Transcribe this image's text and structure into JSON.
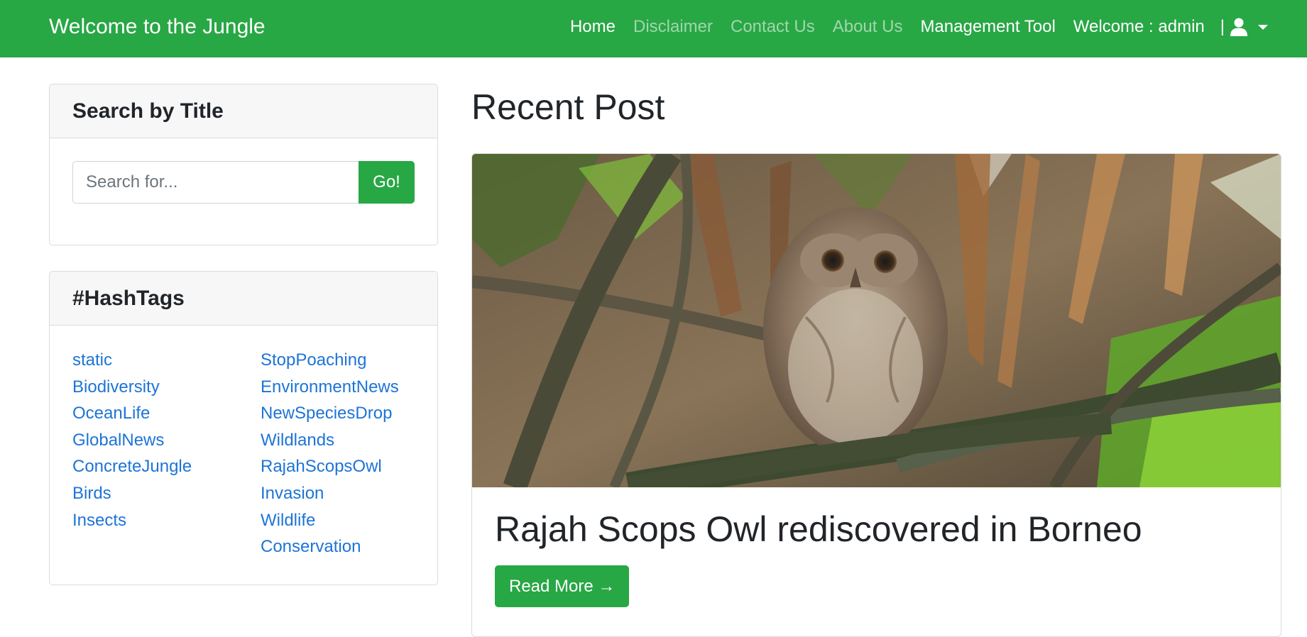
{
  "navbar": {
    "brand": "Welcome to the Jungle",
    "links": [
      "Home",
      "Disclaimer",
      "Contact Us",
      "About Us",
      "Management Tool"
    ],
    "welcome": "Welcome : admin",
    "separator": "|",
    "user_icon": "user-icon",
    "caret_icon": "caret-down-icon"
  },
  "search": {
    "title": "Search by Title",
    "placeholder": "Search for...",
    "value": "",
    "button": "Go!"
  },
  "hashtags": {
    "title": "#HashTags",
    "left": [
      "static",
      "Biodiversity",
      "OceanLife",
      "GlobalNews",
      "ConcreteJungle",
      "Birds",
      "Insects"
    ],
    "right": [
      "StopPoaching",
      "EnvironmentNews",
      "NewSpeciesDrop",
      "Wildlands",
      "RajahScopsOwl",
      "Invasion",
      "Wildlife",
      "Conservation"
    ]
  },
  "main": {
    "heading": "Recent Post",
    "post": {
      "image": "owl-photo",
      "title": "Rajah Scops Owl rediscovered in Borneo",
      "read_more": "Read More →"
    }
  },
  "colors": {
    "brand_green": "#28a745",
    "link_blue": "#1d74d6"
  }
}
